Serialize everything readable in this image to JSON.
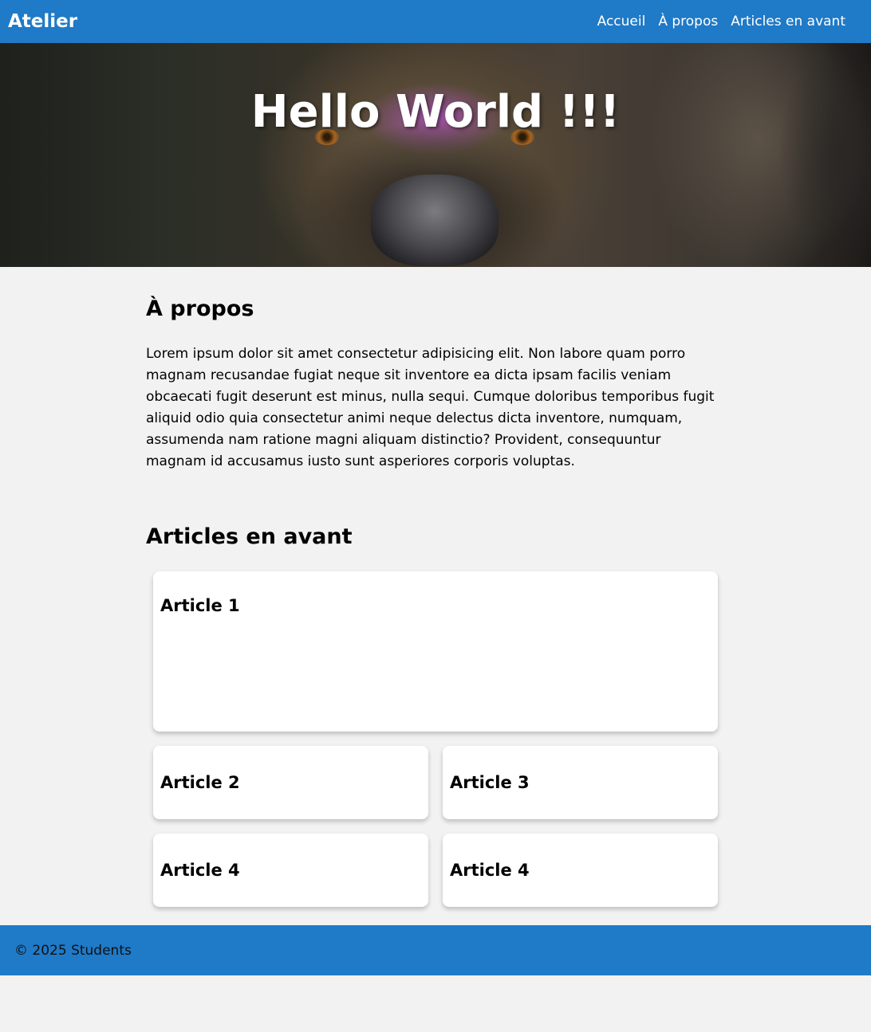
{
  "header": {
    "brand": "Atelier",
    "nav": [
      {
        "label": "Accueil"
      },
      {
        "label": "À propos"
      },
      {
        "label": "Articles en avant"
      }
    ]
  },
  "hero": {
    "title": "Hello World !!!",
    "image_subject": "lioness-face"
  },
  "about": {
    "title": "À propos",
    "text": "Lorem ipsum dolor sit amet consectetur adipisicing elit. Non labore quam porro magnam recusandae fugiat neque sit inventore ea dicta ipsam facilis veniam obcaecati fugit deserunt est minus, nulla sequi. Cumque doloribus temporibus fugit aliquid odio quia consectetur animi neque delectus dicta inventore, numquam, assumenda nam ratione magni aliquam distinctio? Provident, consequuntur magnam id accusamus iusto sunt asperiores corporis voluptas."
  },
  "articles": {
    "title": "Articles en avant",
    "items": [
      {
        "title": "Article 1"
      },
      {
        "title": "Article 2"
      },
      {
        "title": "Article 3"
      },
      {
        "title": "Article 4"
      },
      {
        "title": "Article 4"
      }
    ]
  },
  "footer": {
    "text": "© 2025 Students"
  },
  "colors": {
    "primary": "#1f7ac7",
    "page_background": "#f2f2f2",
    "card_background": "#ffffff"
  }
}
